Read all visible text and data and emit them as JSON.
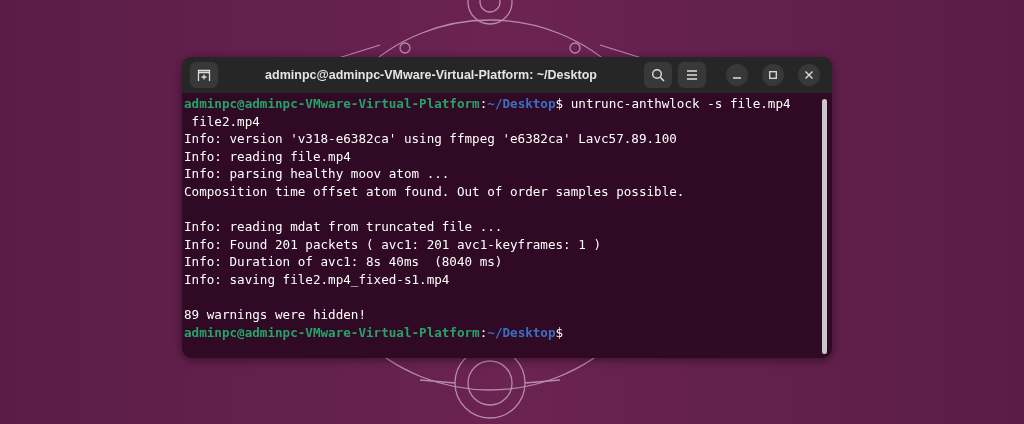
{
  "window": {
    "title": "adminpc@adminpc-VMware-Virtual-Platform: ~/Desktop"
  },
  "terminal": {
    "lines": [
      {
        "kind": "prompt",
        "user_host": "adminpc@adminpc-VMware-Virtual-Platform",
        "separator": ":",
        "path": "~/Desktop",
        "symbol": "$",
        "command": " untrunc-anthwlock -s file.mp4"
      },
      {
        "kind": "output",
        "text": " file2.mp4"
      },
      {
        "kind": "output",
        "text": "Info: version 'v318-e6382ca' using ffmpeg 'e6382ca' Lavc57.89.100"
      },
      {
        "kind": "output",
        "text": "Info: reading file.mp4"
      },
      {
        "kind": "output",
        "text": "Info: parsing healthy moov atom ..."
      },
      {
        "kind": "output",
        "text": "Composition time offset atom found. Out of order samples possible."
      },
      {
        "kind": "blank"
      },
      {
        "kind": "output",
        "text": "Info: reading mdat from truncated file ..."
      },
      {
        "kind": "output",
        "text": "Info: Found 201 packets ( avc1: 201 avc1-keyframes: 1 )"
      },
      {
        "kind": "output",
        "text": "Info: Duration of avc1: 8s 40ms  (8040 ms)"
      },
      {
        "kind": "output",
        "text": "Info: saving file2.mp4_fixed-s1.mp4"
      },
      {
        "kind": "blank"
      },
      {
        "kind": "output",
        "text": "89 warnings were hidden!"
      },
      {
        "kind": "prompt",
        "user_host": "adminpc@adminpc-VMware-Virtual-Platform",
        "separator": ":",
        "path": "~/Desktop",
        "symbol": "$"
      }
    ]
  }
}
